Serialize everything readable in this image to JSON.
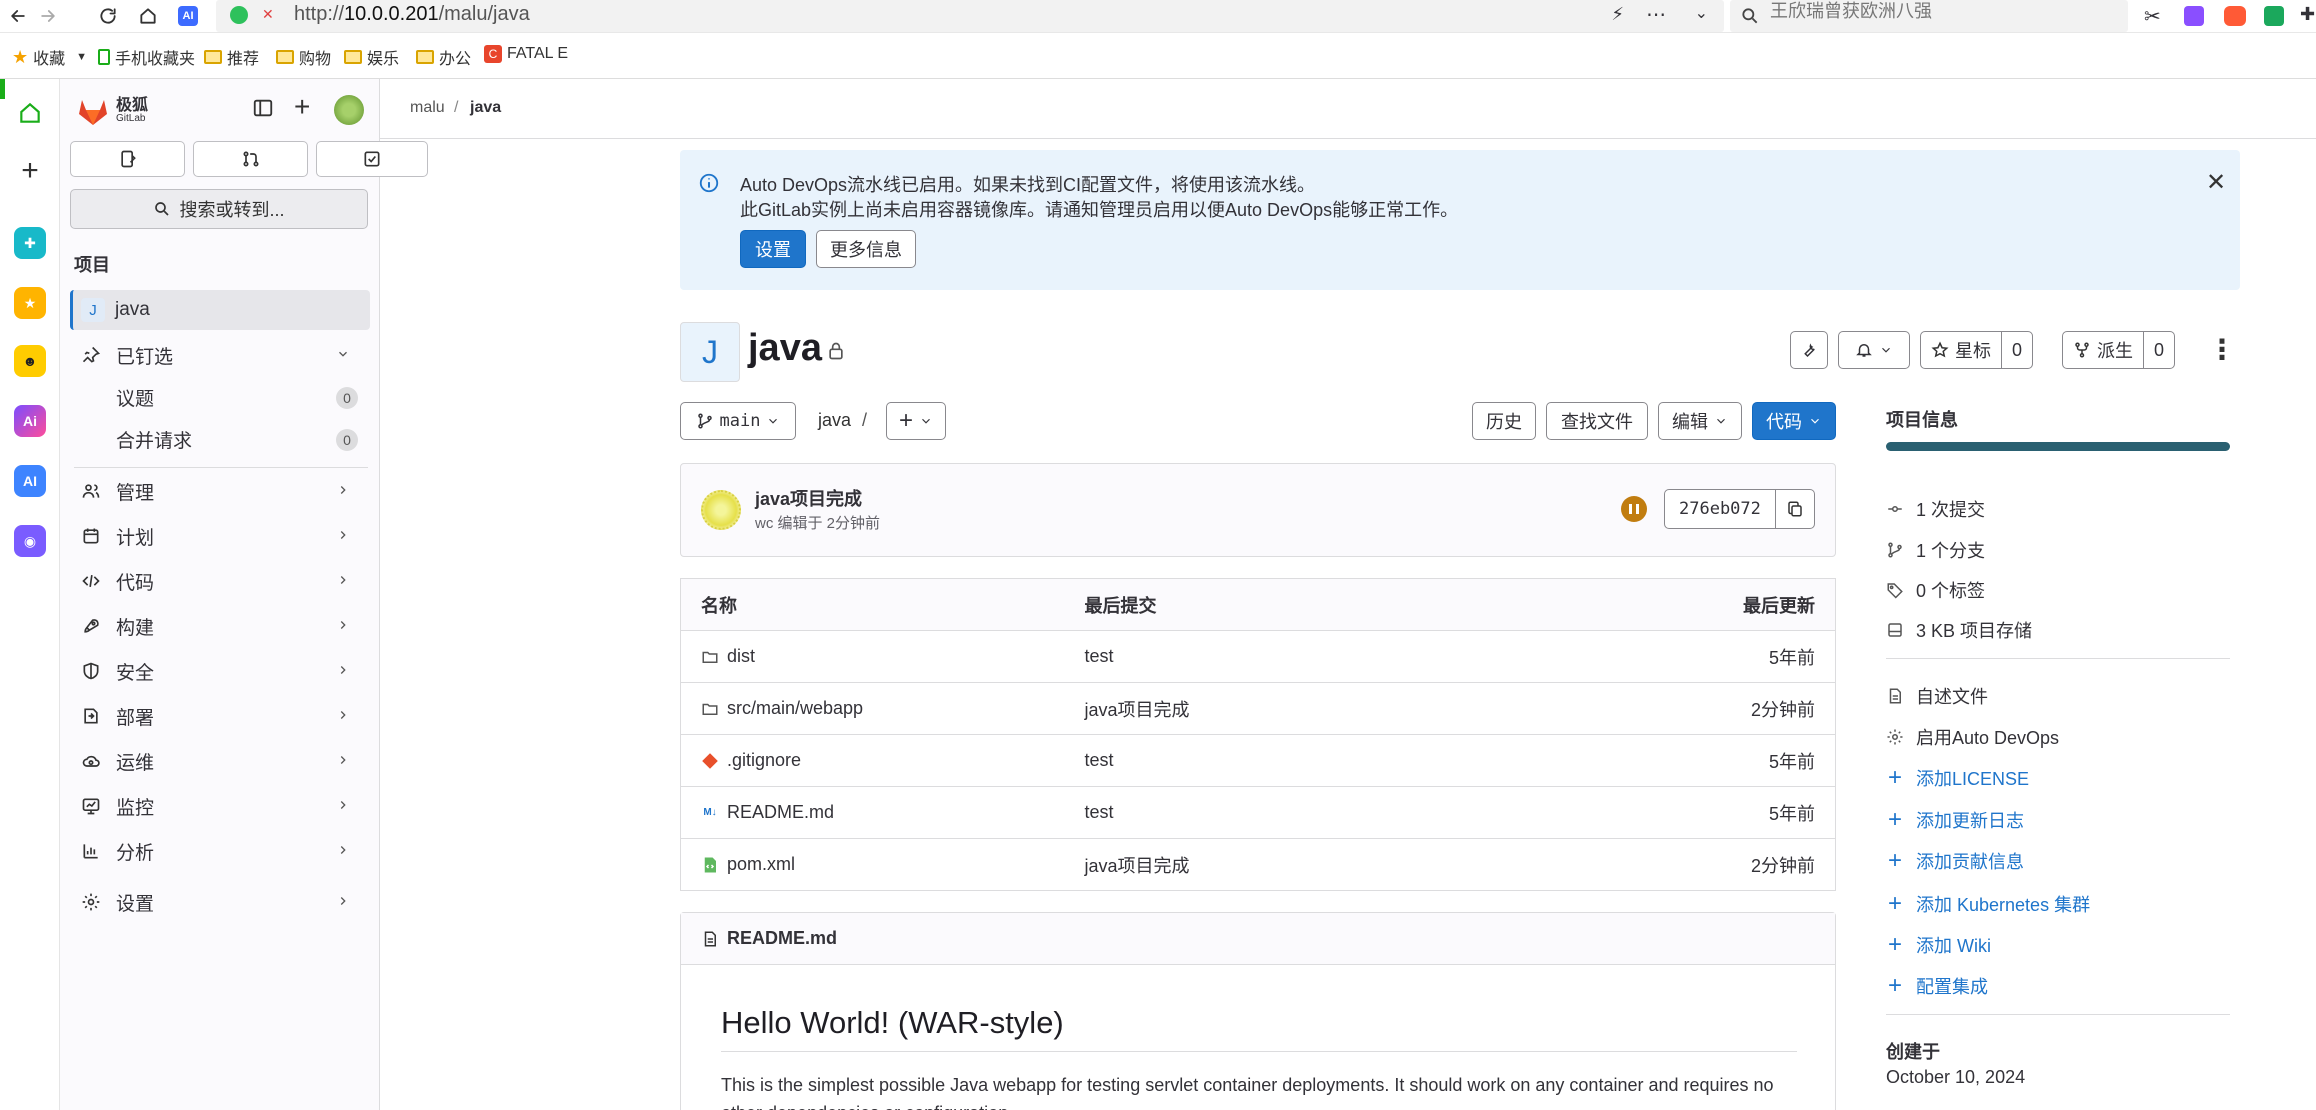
{
  "browser": {
    "url_prefix": "http://",
    "url_host": "10.0.0.201",
    "url_path": "/malu/java",
    "search_placeholder": "王欣瑞曾获欧洲八强",
    "bookmarks": [
      {
        "label": "收藏",
        "icon": "star-icon"
      },
      {
        "label": "手机收藏夹",
        "icon": "phone-icon"
      },
      {
        "label": "推荐",
        "icon": "folder-icon"
      },
      {
        "label": "购物",
        "icon": "folder-icon"
      },
      {
        "label": "娱乐",
        "icon": "folder-icon"
      },
      {
        "label": "办公",
        "icon": "folder-icon"
      },
      {
        "label": "FATAL E",
        "icon": "c-logo-icon"
      }
    ]
  },
  "gitlab": {
    "logo_text": "极狐",
    "logo_sub": "GitLab",
    "search_label": "搜索或转到...",
    "section_title": "项目",
    "project_item": {
      "avatar": "J",
      "label": "java"
    },
    "pinned": {
      "label": "已钉选",
      "items": [
        {
          "label": "议题",
          "count": "0"
        },
        {
          "label": "合并请求",
          "count": "0"
        }
      ]
    },
    "nav": [
      {
        "label": "管理",
        "icon": "users-icon"
      },
      {
        "label": "计划",
        "icon": "calendar-icon"
      },
      {
        "label": "代码",
        "icon": "code-icon"
      },
      {
        "label": "构建",
        "icon": "rocket-icon"
      },
      {
        "label": "安全",
        "icon": "shield-icon"
      },
      {
        "label": "部署",
        "icon": "deploy-icon"
      },
      {
        "label": "运维",
        "icon": "cloud-gear-icon"
      },
      {
        "label": "监控",
        "icon": "monitor-icon"
      },
      {
        "label": "分析",
        "icon": "chart-icon"
      },
      {
        "label": "设置",
        "icon": "gear-icon"
      }
    ]
  },
  "breadcrumb": {
    "parent": "malu",
    "sep": "/",
    "current": "java"
  },
  "alert": {
    "line1": "Auto DevOps流水线已启用。如果未找到CI配置文件，将使用该流水线。",
    "line2": "此GitLab实例上尚未启用容器镜像库。请通知管理员启用以便Auto DevOps能够正常工作。",
    "settings_btn": "设置",
    "more_btn": "更多信息"
  },
  "project": {
    "avatar": "J",
    "name": "java",
    "star_label": "星标",
    "star_count": "0",
    "fork_label": "派生",
    "fork_count": "0"
  },
  "repo_bar": {
    "branch": "main",
    "path": "java",
    "path_sep": "/",
    "history": "历史",
    "find_file": "查找文件",
    "edit": "编辑",
    "code": "代码"
  },
  "commit": {
    "title": "java项目完成",
    "meta": "wc 编辑于 2分钟前",
    "sha": "276eb072"
  },
  "files": {
    "headers": {
      "name": "名称",
      "last_commit": "最后提交",
      "last_update": "最后更新"
    },
    "rows": [
      {
        "name": "dist",
        "icon": "folder-icon",
        "commit": "test",
        "updated": "5年前"
      },
      {
        "name": "src/main/webapp",
        "icon": "folder-icon",
        "commit": "java项目完成",
        "updated": "2分钟前"
      },
      {
        "name": ".gitignore",
        "icon": "git-icon",
        "commit": "test",
        "updated": "5年前"
      },
      {
        "name": "README.md",
        "icon": "markdown-icon",
        "commit": "test",
        "updated": "5年前"
      },
      {
        "name": "pom.xml",
        "icon": "xml-file-icon",
        "commit": "java项目完成",
        "updated": "2分钟前"
      }
    ]
  },
  "readme": {
    "file": "README.md",
    "heading": "Hello World! (WAR-style)",
    "para": "This is the simplest possible Java webapp for testing servlet container deployments. It should work on any container and requires no other dependencies or configuration."
  },
  "info": {
    "title": "项目信息",
    "stats": [
      {
        "label": "1 次提交",
        "icon": "commit-icon"
      },
      {
        "label": "1 个分支",
        "icon": "branch-icon"
      },
      {
        "label": "0 个标签",
        "icon": "tag-icon"
      },
      {
        "label": "3 KB 项目存储",
        "icon": "storage-icon"
      }
    ],
    "readme_link": "自述文件",
    "autodevops_link": "启用Auto DevOps",
    "adds": [
      "添加LICENSE",
      "添加更新日志",
      "添加贡献信息",
      "添加 Kubernetes 集群",
      "添加 Wiki",
      "配置集成"
    ],
    "created_label": "创建于",
    "created_date": "October 10, 2024"
  },
  "colors": {
    "primary": "#1f75cb",
    "alert_bg": "#e9f3fc",
    "pipeline": "#c17d10"
  }
}
